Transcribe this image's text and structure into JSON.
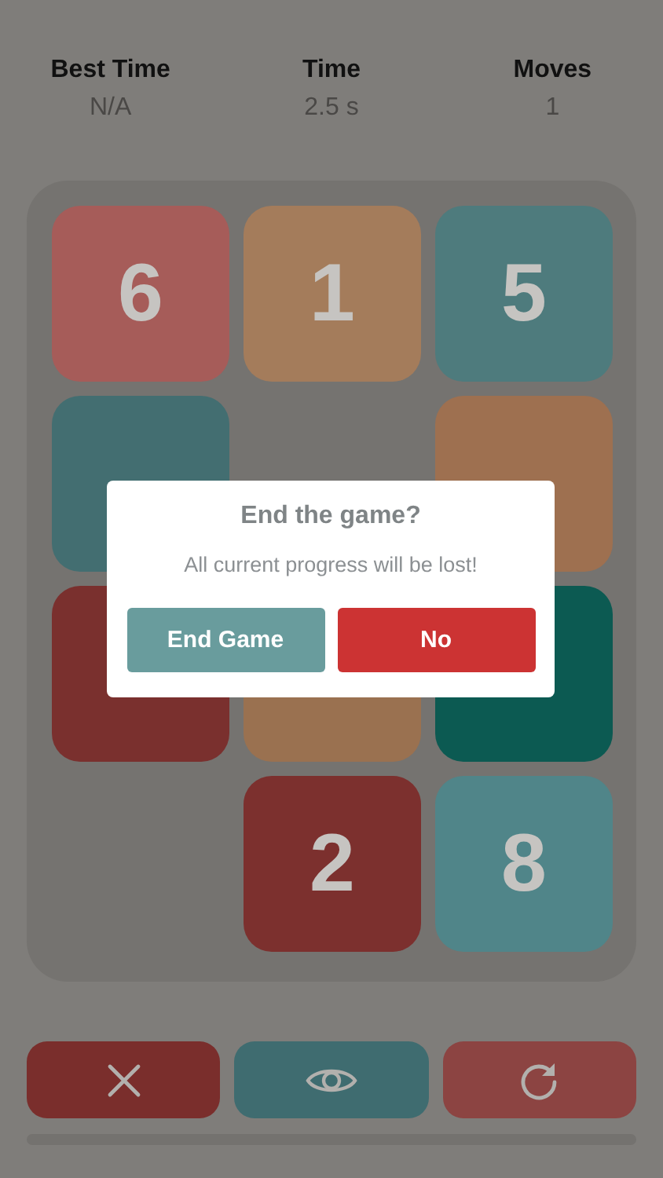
{
  "stats": [
    {
      "label": "Best Time",
      "value": "N/A"
    },
    {
      "label": "Time",
      "value": "2.5 s"
    },
    {
      "label": "Moves",
      "value": "1"
    }
  ],
  "board": {
    "tiles": [
      {
        "kind": "tile",
        "label": "6",
        "color": "#a65c59"
      },
      {
        "kind": "tile",
        "label": "1",
        "color": "#a47c5b"
      },
      {
        "kind": "tile",
        "label": "5",
        "color": "#4e7b7d"
      },
      {
        "kind": "tile",
        "color": "#436e71"
      },
      {
        "kind": "empty"
      },
      {
        "kind": "tile",
        "color": "#9e7050"
      },
      {
        "kind": "tile",
        "color": "#7a302e"
      },
      {
        "kind": "tile",
        "color": "#9a7150"
      },
      {
        "kind": "tile",
        "color": "#0c5a52"
      },
      {
        "kind": "empty"
      },
      {
        "kind": "tile",
        "label": "2",
        "color": "#7c302e"
      },
      {
        "kind": "tile",
        "label": "8",
        "color": "#508589"
      }
    ]
  },
  "dialog": {
    "title": "End the game?",
    "message": "All current progress will be lost!",
    "buttons": [
      {
        "label": "End Game",
        "kind": "secondary"
      },
      {
        "label": "No",
        "kind": "primary"
      }
    ]
  },
  "toolbar": [
    {
      "kind": "close",
      "color": "#7a2e2c"
    },
    {
      "kind": "eye",
      "color": "#3f6c70"
    },
    {
      "kind": "refresh",
      "color": "#8c4442"
    }
  ]
}
